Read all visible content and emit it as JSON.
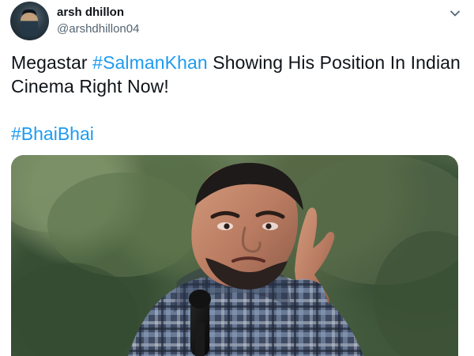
{
  "tweet": {
    "author": {
      "name": "arsh dhillon",
      "handle": "@arshdhillon04"
    },
    "text_line1_prefix": "Megastar ",
    "hashtag_1": "#SalmanKhan",
    "text_line1_suffix": " Showing His Position In Indian",
    "text_line2": "Cinema Right Now!",
    "hashtag_2": "#BhaiBhai"
  },
  "icons": {
    "menu": "chevron-down-icon",
    "avatar": "avatar"
  },
  "colors": {
    "link": "#1d9bf0",
    "text": "#0f1419",
    "secondary_text": "#536471"
  }
}
